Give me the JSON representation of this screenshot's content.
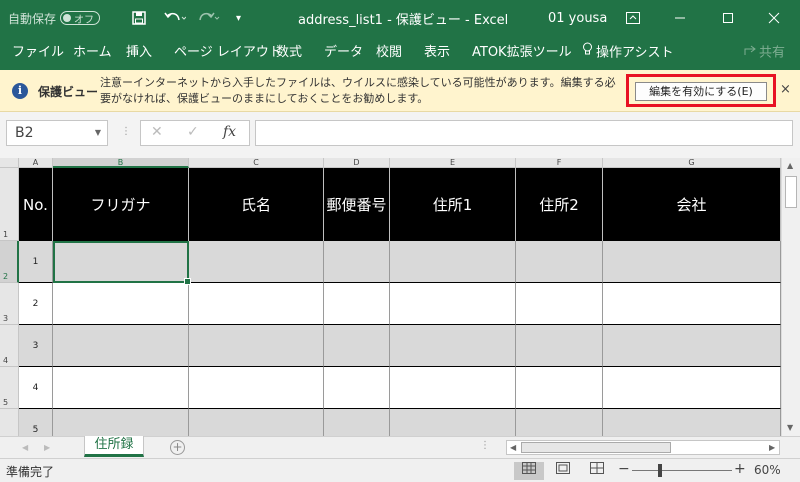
{
  "titlebar": {
    "autosave_label": "自動保存",
    "autosave_state": "オフ",
    "doc_title": "address_list1  -  保護ビュー  -  Excel",
    "user": "01 yousa"
  },
  "ribbon": {
    "tabs": [
      "ファイル",
      "ホーム",
      "挿入",
      "ページ レイアウト",
      "数式",
      "データ",
      "校閲",
      "表示",
      "ATOK拡張ツール"
    ],
    "assist": "操作アシスト",
    "share": "共有"
  },
  "protected_view": {
    "title": "保護ビュー",
    "message": "注意ーインターネットから入手したファイルは、ウイルスに感染している可能性があります。編集する必要がなければ、保護ビューのままにしておくことをお勧めします。",
    "enable_button": "編集を有効にする(E)",
    "close": "×"
  },
  "formula_bar": {
    "name_box": "B2",
    "cancel": "✕",
    "confirm": "✓",
    "fx": "fx",
    "content": ""
  },
  "sheet": {
    "columns": [
      "A",
      "B",
      "C",
      "D",
      "E",
      "F",
      "G"
    ],
    "rows": [
      "1",
      "2",
      "3",
      "4",
      "5"
    ],
    "header_cells": [
      "No.",
      "フリガナ",
      "氏名",
      "郵便番号",
      "住所1",
      "住所2",
      "会社"
    ],
    "numbers": [
      "1",
      "2",
      "3",
      "4",
      "5"
    ],
    "selected_column": "B",
    "selected_row": "2"
  },
  "tabs": {
    "sheet_name": "住所録",
    "add": "+"
  },
  "status": {
    "ready": "準備完了",
    "zoom_minus": "−",
    "zoom_plus": "+",
    "zoom": "60%"
  },
  "colors": {
    "excel_green": "#217346",
    "protect_bar": "#fff4ce",
    "highlight_red": "#e81123",
    "header_black": "#000000",
    "band_gray": "#d9d9d9"
  }
}
